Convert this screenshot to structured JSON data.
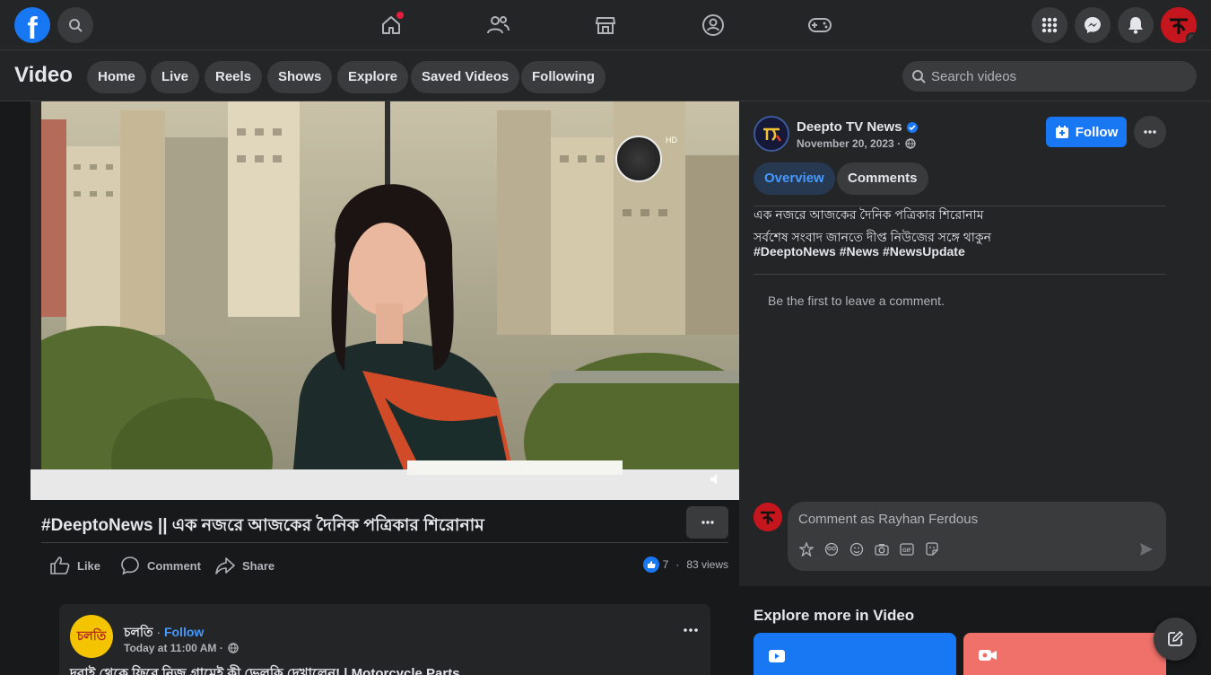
{
  "topbar": {
    "logo": "f",
    "icons": [
      "search-icon",
      "home-icon",
      "friends-icon",
      "marketplace-icon",
      "groups-icon",
      "gaming-icon",
      "menu-grid-icon",
      "messenger-icon",
      "notifications-icon"
    ],
    "home_has_notification": true
  },
  "video_header": {
    "title": "Video",
    "tabs": [
      {
        "label": "Home"
      },
      {
        "label": "Live"
      },
      {
        "label": "Reels"
      },
      {
        "label": "Shows"
      },
      {
        "label": "Explore"
      },
      {
        "label": "Saved Videos"
      },
      {
        "label": "Following"
      }
    ],
    "search_placeholder": "Search videos"
  },
  "video": {
    "channel_logo_text": "দীপ্ত",
    "hd": "HD",
    "title": "#DeeptoNews || এক নজরে আজকের দৈনিক পত্রিকার শিরোনাম",
    "actions": {
      "like": "Like",
      "comment": "Comment",
      "share": "Share"
    },
    "reaction_count": "7",
    "separator": "·",
    "views": "83 views"
  },
  "page": {
    "name": "Deepto TV News",
    "date": "November 20, 2023 ·",
    "follow_label": "Follow",
    "tabs": {
      "overview": "Overview",
      "comments": "Comments"
    },
    "description_line1": "এক নজরে আজকের দৈনিক পত্রিকার শিরোনাম",
    "description_line2": "সর্বশেষ সংবাদ জানতে দীপ্ত নিউজের সঙ্গে থাকুন",
    "hashtags": "#DeeptoNews #News #NewsUpdate",
    "no_comments": "Be the first to leave a comment.",
    "comment_placeholder": "Comment as Rayhan Ferdous"
  },
  "next_post": {
    "avatar_text": "চলতি",
    "name": "চলতি",
    "separator": "·",
    "follow_label": "Follow",
    "time": "Today at 11:00 AM ·",
    "title": "দুবাই থেকে ফিরে নিজ গ্রামেই কী ভেলকি দেখালেন! | Motorcycle Parts"
  },
  "explore": {
    "title": "Explore more in Video"
  },
  "colors": {
    "accent": "#1877f2",
    "background": "#18191a",
    "surface": "#242526",
    "pill": "#3a3b3c"
  }
}
